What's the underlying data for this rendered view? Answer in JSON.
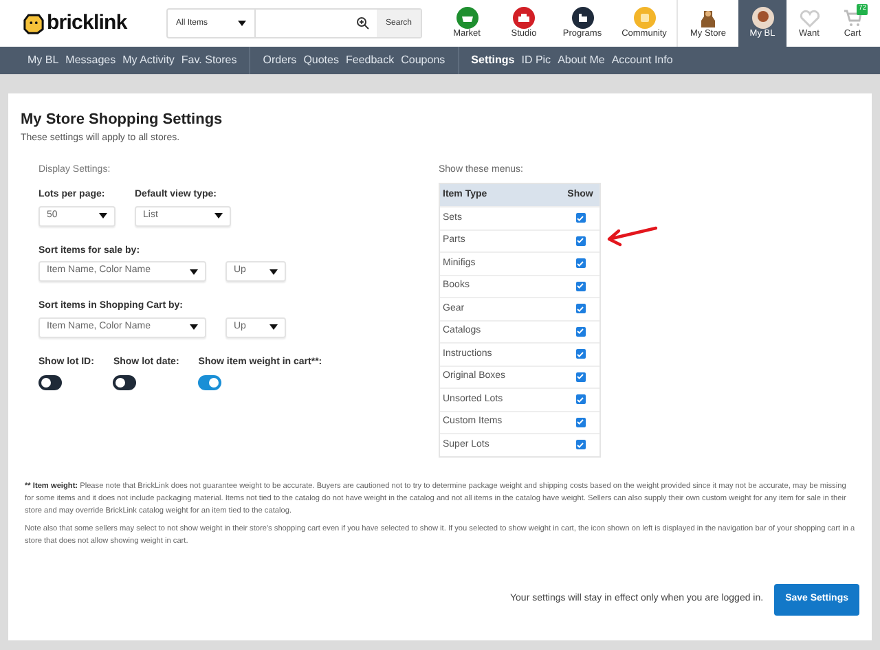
{
  "header": {
    "logo": "bricklink",
    "search_category": "All Items",
    "search_button": "Search",
    "nav_icons": [
      {
        "label": "Market",
        "kind": "market",
        "selected": false
      },
      {
        "label": "Studio",
        "kind": "studio",
        "selected": false
      },
      {
        "label": "Programs",
        "kind": "programs",
        "selected": false
      },
      {
        "label": "Community",
        "kind": "community",
        "selected": false
      },
      {
        "label": "My Store",
        "kind": "store",
        "selected": false
      },
      {
        "label": "My BL",
        "kind": "mybl",
        "selected": true
      },
      {
        "label": "Want",
        "kind": "want",
        "selected": false
      },
      {
        "label": "Cart",
        "kind": "cart",
        "selected": false,
        "badge": "72"
      }
    ]
  },
  "subnav": [
    [
      {
        "label": "My BL",
        "selected": false
      },
      {
        "label": "Messages",
        "selected": false
      },
      {
        "label": "My Activity",
        "selected": false
      },
      {
        "label": "Fav. Stores",
        "selected": false
      }
    ],
    [
      {
        "label": "Orders",
        "selected": false
      },
      {
        "label": "Quotes",
        "selected": false
      },
      {
        "label": "Feedback",
        "selected": false
      },
      {
        "label": "Coupons",
        "selected": false
      }
    ],
    [
      {
        "label": "Settings",
        "selected": true
      },
      {
        "label": "ID Pic",
        "selected": false
      },
      {
        "label": "About Me",
        "selected": false
      },
      {
        "label": "Account Info",
        "selected": false
      }
    ]
  ],
  "page": {
    "title": "My Store Shopping Settings",
    "subtitle": "These settings will apply to all stores.",
    "display_label": "Display Settings:",
    "lots_per_page": {
      "label": "Lots per page:",
      "value": "50"
    },
    "view_type": {
      "label": "Default view type:",
      "value": "List"
    },
    "sort_sale": {
      "label": "Sort items for sale by:",
      "value": "Item Name, Color Name",
      "direction": "Up"
    },
    "sort_cart": {
      "label": "Sort items in Shopping Cart by:",
      "value": "Item Name, Color Name",
      "direction": "Up"
    },
    "toggles": [
      {
        "label": "Show lot ID:",
        "on": false
      },
      {
        "label": "Show lot date:",
        "on": false
      },
      {
        "label": "Show item weight in cart**:",
        "on": true
      }
    ],
    "menus_label": "Show these menus:",
    "menus_columns": [
      "Item Type",
      "Show"
    ],
    "menus": [
      {
        "name": "Sets",
        "checked": true
      },
      {
        "name": "Parts",
        "checked": true
      },
      {
        "name": "Minifigs",
        "checked": true
      },
      {
        "name": "Books",
        "checked": true
      },
      {
        "name": "Gear",
        "checked": true
      },
      {
        "name": "Catalogs",
        "checked": true
      },
      {
        "name": "Instructions",
        "checked": true
      },
      {
        "name": "Original Boxes",
        "checked": true
      },
      {
        "name": "Unsorted Lots",
        "checked": true
      },
      {
        "name": "Custom Items",
        "checked": true
      },
      {
        "name": "Super Lots",
        "checked": true
      }
    ],
    "footnote": {
      "label": "** Item weight:",
      "text": "Please note that BrickLink does not guarantee weight to be accurate. Buyers are cautioned not to try to determine package weight and shipping costs based on the weight provided since it may not be accurate, may be missing for some items and it does not include packaging material. Items not tied to the catalog do not have weight in the catalog and not all items in the catalog have weight. Sellers can also supply their own custom weight for any item for sale in their store and may override BrickLink catalog weight for an item tied to the catalog."
    },
    "note": "Note also that some sellers may select to not show weight in their store's shopping cart even if you have selected to show it. If you selected to show weight in cart, the icon shown on left is displayed in the navigation bar of your shopping cart in a store that does not allow showing weight in cart.",
    "login_note": "Your settings will stay in effect only when you are logged in.",
    "save_button": "Save Settings"
  }
}
